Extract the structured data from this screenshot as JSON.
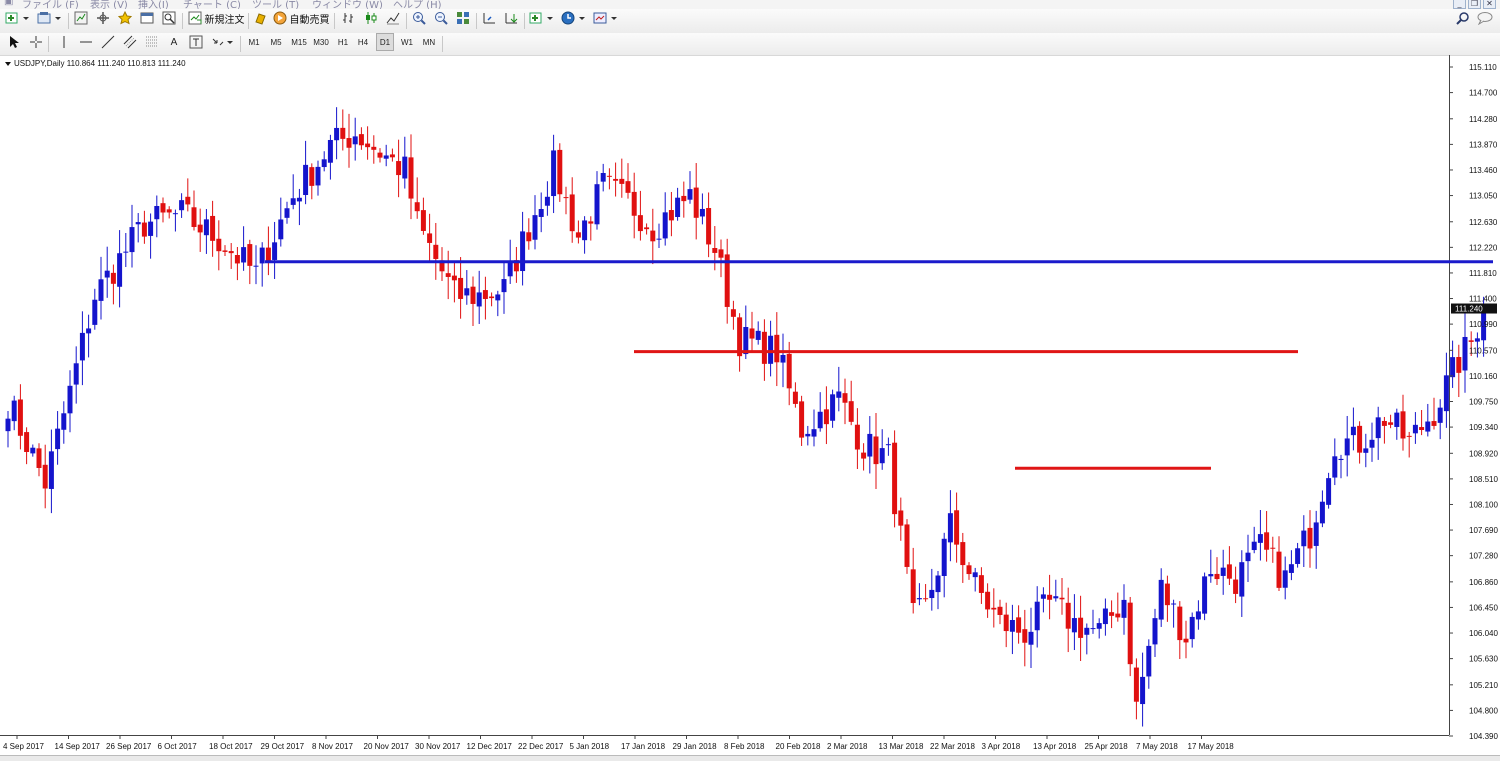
{
  "menubar": {
    "items": [
      "ファイル (F)",
      "表示 (V)",
      "挿入(I)",
      "チャート (C)",
      "ツール (T)",
      "ウィンドウ (W)",
      "ヘルプ (H)"
    ]
  },
  "toolbar1": {
    "new_order_label": "新規注文",
    "autotrade_label": "自動売買"
  },
  "toolbar2": {
    "timeframes": [
      "M1",
      "M5",
      "M15",
      "M30",
      "H1",
      "H4",
      "D1",
      "W1",
      "MN"
    ],
    "active_timeframe": "D1",
    "text_tool": "A"
  },
  "chart": {
    "header": "USDJPY,Daily  110.864 111.240 110.813 111.240",
    "current_price_label": "111.240",
    "colors": {
      "bull": "#1414cc",
      "bear": "#e01010",
      "hline_blue": "#1a1acc",
      "hline_red": "#e01515",
      "price_box": "#111111"
    }
  },
  "chart_data": {
    "type": "candlestick",
    "symbol": "USDJPY",
    "timeframe": "Daily",
    "ohlc_header": [
      110.864,
      111.24,
      110.813,
      111.24
    ],
    "y_ticks": [
      "115.110",
      "114.700",
      "114.280",
      "113.870",
      "113.460",
      "113.050",
      "112.630",
      "112.220",
      "111.810",
      "111.400",
      "110.990",
      "110.570",
      "110.160",
      "109.750",
      "109.340",
      "108.920",
      "108.510",
      "108.100",
      "107.690",
      "107.280",
      "106.860",
      "106.450",
      "106.040",
      "105.630",
      "105.210",
      "104.800",
      "104.390"
    ],
    "ylim": [
      104.39,
      115.11
    ],
    "x_tick_labels": [
      "4 Sep 2017",
      "14 Sep 2017",
      "26 Sep 2017",
      "6 Oct 2017",
      "18 Oct 2017",
      "29 Oct 2017",
      "8 Nov 2017",
      "20 Nov 2017",
      "30 Nov 2017",
      "12 Dec 2017",
      "22 Dec 2017",
      "5 Jan 2018",
      "17 Jan 2018",
      "29 Jan 2018",
      "8 Feb 2018",
      "20 Feb 2018",
      "2 Mar 2018",
      "13 Mar 2018",
      "22 Mar 2018",
      "3 Apr 2018",
      "13 Apr 2018",
      "25 Apr 2018",
      "7 May 2018",
      "17 May 2018"
    ],
    "horizontal_lines": [
      {
        "color": "blue",
        "price": 111.99
      },
      {
        "color": "red",
        "price": 110.55
      },
      {
        "color": "red",
        "price": 108.68
      }
    ],
    "candle_keypoints": [
      [
        0,
        109.75
      ],
      [
        6,
        108.45
      ],
      [
        10,
        109.9
      ],
      [
        14,
        111.45
      ],
      [
        22,
        112.6
      ],
      [
        28,
        112.75
      ],
      [
        34,
        112.35
      ],
      [
        40,
        111.8
      ],
      [
        46,
        113.05
      ],
      [
        52,
        113.85
      ],
      [
        56,
        114.05
      ],
      [
        60,
        113.75
      ],
      [
        64,
        113.45
      ],
      [
        66,
        112.6
      ],
      [
        72,
        111.45
      ],
      [
        76,
        111.45
      ],
      [
        80,
        111.55
      ],
      [
        84,
        112.55
      ],
      [
        88,
        113.5
      ],
      [
        92,
        112.4
      ],
      [
        96,
        113.2
      ],
      [
        100,
        112.95
      ],
      [
        104,
        112.55
      ],
      [
        110,
        113.05
      ],
      [
        114,
        112.2
      ],
      [
        118,
        110.75
      ],
      [
        124,
        110.55
      ],
      [
        128,
        109.3
      ],
      [
        134,
        109.8
      ],
      [
        138,
        109.05
      ],
      [
        142,
        108.85
      ],
      [
        146,
        106.25
      ],
      [
        148,
        106.45
      ],
      [
        152,
        107.75
      ],
      [
        156,
        106.8
      ],
      [
        160,
        106.2
      ],
      [
        164,
        106.05
      ],
      [
        168,
        106.5
      ],
      [
        172,
        106.2
      ],
      [
        176,
        106.05
      ],
      [
        180,
        106.6
      ],
      [
        182,
        104.85
      ],
      [
        186,
        106.75
      ],
      [
        190,
        106.0
      ],
      [
        194,
        107.1
      ],
      [
        198,
        106.9
      ],
      [
        202,
        107.4
      ],
      [
        206,
        106.9
      ],
      [
        210,
        107.65
      ],
      [
        214,
        109.1
      ],
      [
        218,
        109.1
      ],
      [
        222,
        109.5
      ],
      [
        226,
        109.1
      ],
      [
        230,
        109.6
      ],
      [
        234,
        110.4
      ],
      [
        236,
        110.7
      ],
      [
        238,
        111.24
      ]
    ]
  }
}
